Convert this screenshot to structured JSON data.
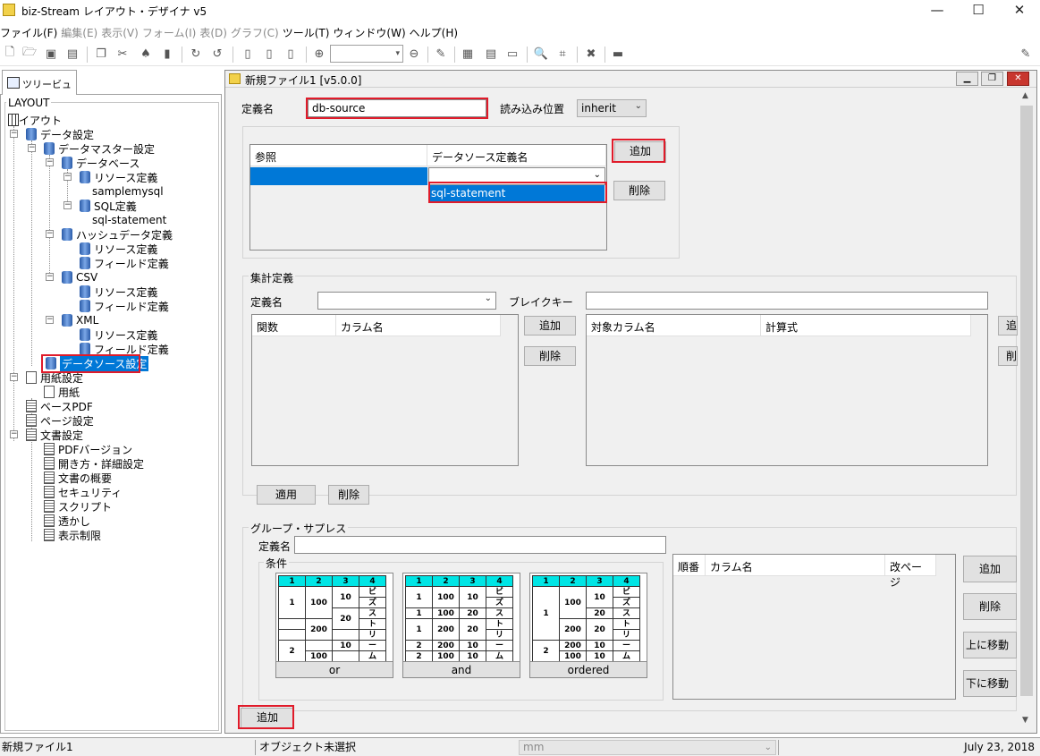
{
  "app": {
    "title": "biz-Stream レイアウト・デザイナ v5",
    "min_glyph": "—",
    "max_glyph": "☐",
    "close_glyph": "✕"
  },
  "menu": [
    "ファイル(F)",
    "編集(E)",
    "表示(V)",
    "フォーム(I)",
    "表(D)",
    "グラフ(C)",
    "ツール(T)",
    "ウィンドウ(W)",
    "ヘルプ(H)"
  ],
  "tree": {
    "tab": "ツリービュー",
    "group_title": "LAYOUT",
    "items": [
      {
        "label": "レイアウト",
        "icon": "grid-icon"
      },
      {
        "label": "データ設定",
        "icon": "db-icon"
      },
      {
        "label": "データマスター設定",
        "icon": "db-icon"
      },
      {
        "label": "データベース",
        "icon": "db-icon"
      },
      {
        "label": "リソース定義",
        "icon": "db-icon"
      },
      {
        "label": "samplemysql",
        "icon": ""
      },
      {
        "label": "SQL定義",
        "icon": "db-icon"
      },
      {
        "label": "sql-statement",
        "icon": ""
      },
      {
        "label": "ハッシュデータ定義",
        "icon": "db-icon"
      },
      {
        "label": "リソース定義",
        "icon": "db-icon"
      },
      {
        "label": "フィールド定義",
        "icon": "db-icon"
      },
      {
        "label": "CSV",
        "icon": "db-icon"
      },
      {
        "label": "リソース定義",
        "icon": "db-icon"
      },
      {
        "label": "フィールド定義",
        "icon": "db-icon"
      },
      {
        "label": "XML",
        "icon": "db-icon"
      },
      {
        "label": "リソース定義",
        "icon": "db-icon"
      },
      {
        "label": "フィールド定義",
        "icon": "db-icon"
      },
      {
        "label": "データソース設定",
        "icon": "db-icon"
      },
      {
        "label": "用紙設定",
        "icon": "page-icon"
      },
      {
        "label": "用紙",
        "icon": "page-icon"
      },
      {
        "label": "ベースPDF",
        "icon": "doc-icon"
      },
      {
        "label": "ページ設定",
        "icon": "doc-icon"
      },
      {
        "label": "文書設定",
        "icon": "doc-icon"
      },
      {
        "label": "PDFバージョン",
        "icon": "doc-icon"
      },
      {
        "label": "開き方・詳細設定",
        "icon": "doc-icon"
      },
      {
        "label": "文書の概要",
        "icon": "doc-icon"
      },
      {
        "label": "セキュリティ",
        "icon": "doc-icon"
      },
      {
        "label": "スクリプト",
        "icon": "doc-icon"
      },
      {
        "label": "透かし",
        "icon": "doc-icon"
      },
      {
        "label": "表示制限",
        "icon": "doc-icon"
      }
    ]
  },
  "doc": {
    "title": "新規ファイル1 [v5.0.0]",
    "def_name_label": "定義名",
    "def_name_value": "db-source",
    "read_pos_label": "読み込み位置",
    "read_pos_value": "inherit",
    "ref_grid": {
      "col_ref": "参照",
      "col_ds": "データソース定義名",
      "dropdown_option": "sql-statement"
    },
    "add_btn": "追加",
    "delete_btn": "削除",
    "agg": {
      "title": "集計定義",
      "def_name_label": "定義名",
      "break_key_label": "ブレイクキー",
      "col_func": "関数",
      "col_colname": "カラム名",
      "add_btn": "追加",
      "delete_btn": "削除",
      "col_target": "対象カラム名",
      "col_expr": "計算式",
      "apply_btn": "適用",
      "delete_btn2": "削除",
      "right_btn1": "追",
      "right_btn2": "削"
    },
    "gs": {
      "title": "グループ・サプレス",
      "def_name_label": "定義名",
      "cond_label": "条件",
      "cond_or": "or",
      "cond_and": "and",
      "cond_ordered": "ordered",
      "col_order": "順番",
      "col_colname": "カラム名",
      "col_pagebreak": "改ページ",
      "add_btn": "追加",
      "delete_btn": "削除",
      "up_btn": "上に移動",
      "down_btn": "下に移動"
    },
    "bottom_add_btn": "追加"
  },
  "status": {
    "file": "新規ファイル1",
    "object": "オブジェクト未選択",
    "unit": "mm",
    "date": "July 23, 2018"
  }
}
